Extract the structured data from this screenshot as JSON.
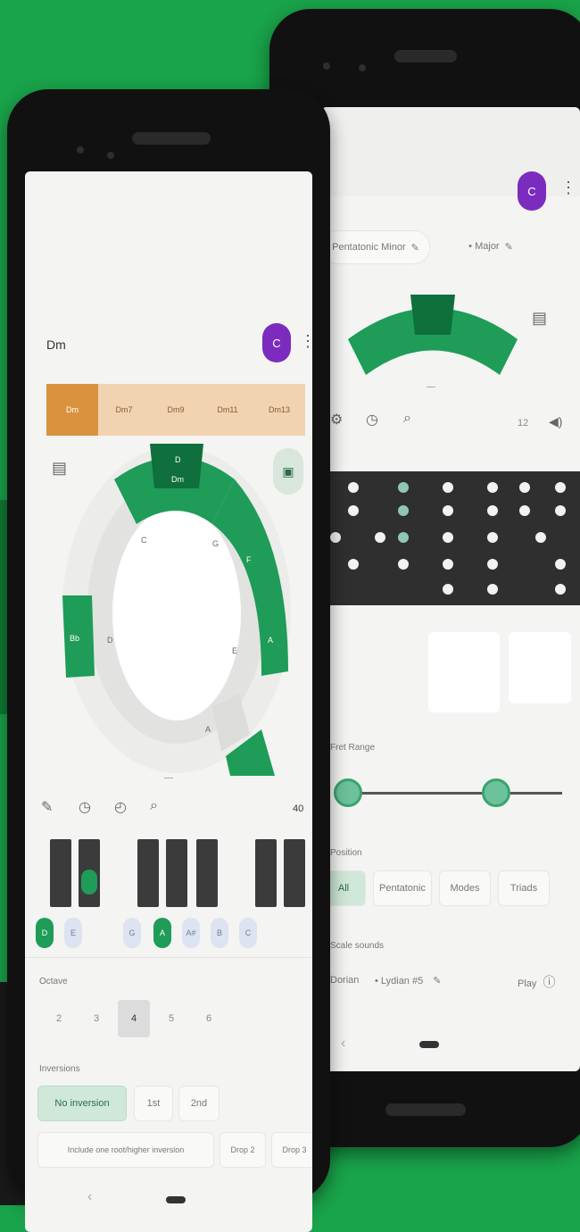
{
  "front": {
    "key_name": "Dm",
    "avatar_initial": "C",
    "tabs": [
      "Dm",
      "Dm7",
      "Dm9",
      "Dm11",
      "Dm13"
    ],
    "circle_notes": [
      "D",
      "Dm",
      "F",
      "A",
      "C",
      "G",
      "E",
      "Bb",
      "D",
      "A"
    ],
    "toolbar_number": "40",
    "piano_notes": [
      "D",
      "E",
      "G",
      "A",
      "A#",
      "B",
      "C"
    ],
    "octave_label": "Octave",
    "octaves": [
      "2",
      "3",
      "4",
      "5",
      "6"
    ],
    "inversions_label": "Inversions",
    "inversion_chips": [
      "No inversion",
      "1st",
      "2nd"
    ],
    "voicing_chips": [
      "Include one root/higher inversion",
      "Drop 2",
      "Drop 3"
    ]
  },
  "back": {
    "avatar_initial": "C",
    "chip_left": "Pentatonic Minor",
    "chip_right": "Major",
    "capo_label": "Capo",
    "fret_count": "12",
    "range_label": "Fret Range",
    "position_label": "Position",
    "position_chips": [
      "All",
      "Pentatonic",
      "Modes",
      "Triads"
    ],
    "scale_label": "Scale sounds",
    "scale_chips": [
      "Dorian",
      "Lydian #5",
      "Play"
    ]
  },
  "colors": {
    "background": "#19a34a",
    "accent_green": "#1e9c58",
    "tab_orange": "#d9933e",
    "avatar_purple": "#7b2cbf"
  }
}
